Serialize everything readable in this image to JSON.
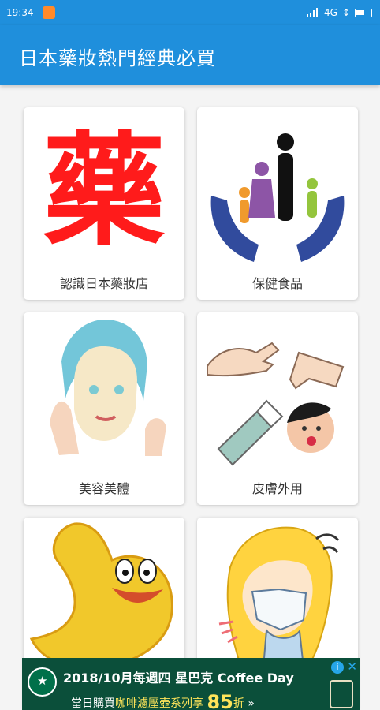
{
  "status_bar": {
    "time": "19:34",
    "network": "4G",
    "signal_icon": "signal-bars-icon",
    "battery_icon": "battery-icon"
  },
  "app_bar": {
    "title": "日本藥妝熱門經典必買"
  },
  "categories": [
    {
      "label": "認識日本藥妝店",
      "icon": "medicine-character-icon",
      "color": "#ff1b1b"
    },
    {
      "label": "保健食品",
      "icon": "family-care-hands-icon",
      "color": "#314b9d"
    },
    {
      "label": "美容美體",
      "icon": "beauty-face-icon",
      "color": "#73c6d9"
    },
    {
      "label": "皮膚外用",
      "icon": "skin-care-icon",
      "color": "#4d9f57"
    },
    {
      "label": "",
      "icon": "stomach-icon",
      "color": "#f1c82b"
    },
    {
      "label": "",
      "icon": "mask-person-icon",
      "color": "#ffd33f"
    }
  ],
  "ad": {
    "headline_a": "2018/10月每週四",
    "headline_b": "星巴克 Coffee Day",
    "subline_a": "當日購買",
    "subline_b": "咖啡濾壓壺系列享",
    "discount": "85",
    "subline_c": "折",
    "arrow": "»",
    "info_icon": "info-icon",
    "close_icon": "close-icon"
  }
}
